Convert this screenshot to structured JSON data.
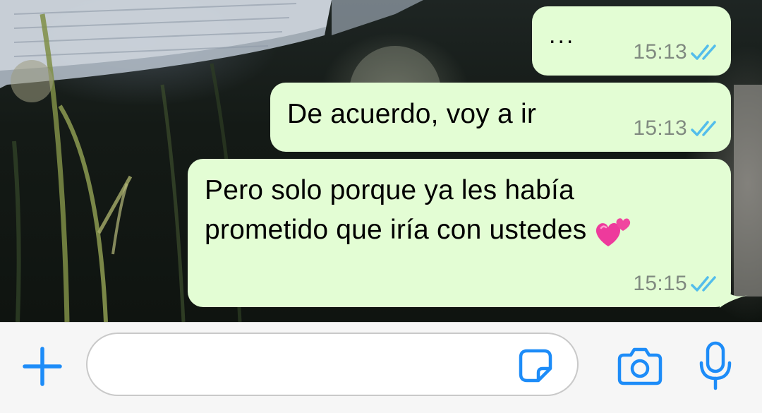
{
  "messages": [
    {
      "text": "...",
      "time": "15:13",
      "status": "read"
    },
    {
      "text": "De acuerdo, voy a ir",
      "time": "15:13",
      "status": "read"
    },
    {
      "line1": "Pero solo porque ya les había",
      "line2": "prometido que iría con ustedes",
      "emoji": "two-hearts",
      "time": "15:15",
      "status": "read"
    }
  ],
  "composer": {
    "placeholder": "",
    "icons": [
      "plus-icon",
      "sticker-icon",
      "camera-icon",
      "microphone-icon"
    ]
  },
  "colors": {
    "bubble_outgoing": "#e3fdd4",
    "accent": "#1d8cf8",
    "read_ticks": "#53bdeb",
    "timestamp": "#808a80",
    "composer_bg": "#f6f6f6"
  }
}
